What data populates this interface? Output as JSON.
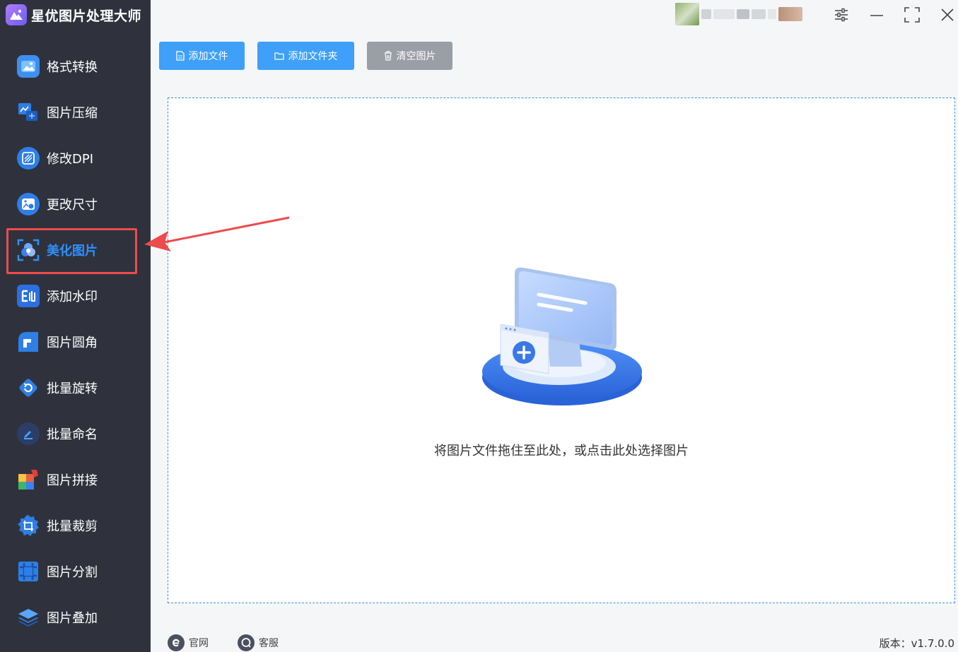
{
  "app": {
    "title": "星优图片处理大师"
  },
  "sidebar": {
    "items": [
      {
        "label": "格式转换",
        "icon": "image-convert-icon",
        "active": false
      },
      {
        "label": "图片压缩",
        "icon": "image-compress-icon",
        "active": false
      },
      {
        "label": "修改DPI",
        "icon": "dpi-icon",
        "active": false
      },
      {
        "label": "更改尺寸",
        "icon": "resize-icon",
        "active": false
      },
      {
        "label": "美化图片",
        "icon": "beautify-icon",
        "active": true
      },
      {
        "label": "添加水印",
        "icon": "watermark-icon",
        "active": false
      },
      {
        "label": "图片圆角",
        "icon": "round-corner-icon",
        "active": false
      },
      {
        "label": "批量旋转",
        "icon": "rotate-icon",
        "active": false
      },
      {
        "label": "批量命名",
        "icon": "rename-icon",
        "active": false
      },
      {
        "label": "图片拼接",
        "icon": "puzzle-icon",
        "active": false
      },
      {
        "label": "批量裁剪",
        "icon": "crop-icon",
        "active": false
      },
      {
        "label": "图片分割",
        "icon": "split-icon",
        "active": false
      },
      {
        "label": "图片叠加",
        "icon": "layers-icon",
        "active": false
      }
    ]
  },
  "toolbar": {
    "add_file": "添加文件",
    "add_folder": "添加文件夹",
    "clear_images": "清空图片"
  },
  "dropzone": {
    "hint": "将图片文件拖住至此处，或点击此处选择图片"
  },
  "footer": {
    "website": "官网",
    "support": "客服",
    "version": "版本：v1.7.0.0"
  },
  "colors": {
    "sidebar_bg": "#2f323d",
    "accent": "#2e90ff",
    "button_blue": "#3ea0f8",
    "button_grey": "#9a9ea6",
    "annotation_red": "#ee4b4b"
  }
}
